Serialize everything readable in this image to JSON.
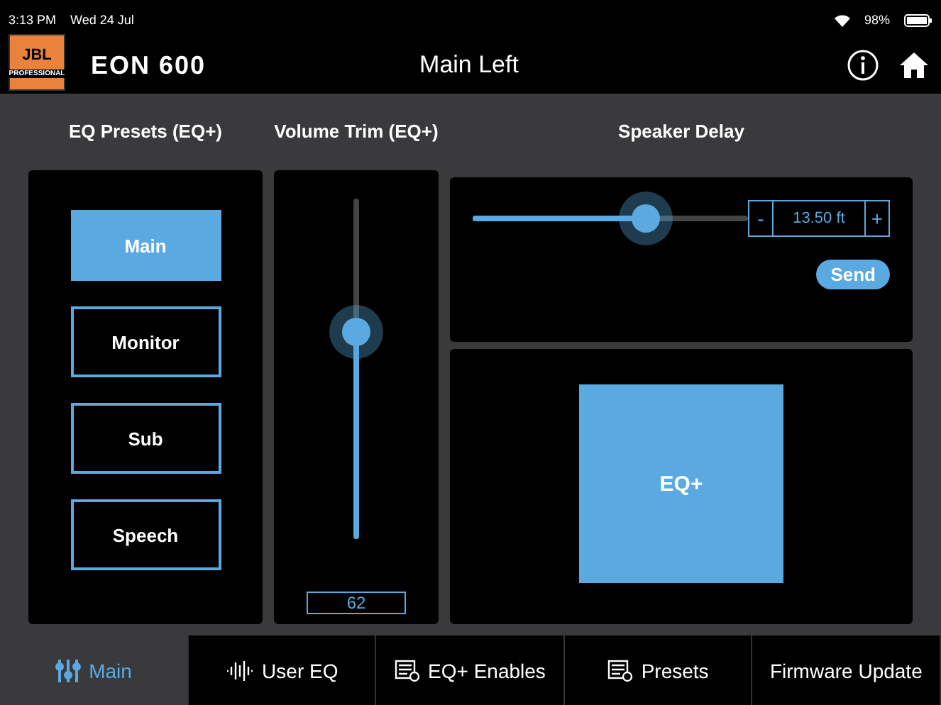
{
  "status_bar": {
    "time": "3:13 PM",
    "date": "Wed 24 Jul",
    "battery_text": "98%"
  },
  "header": {
    "logo": "JBL",
    "logo_sub": "PROFESSIONAL",
    "product": "EON 600",
    "title": "Main Left"
  },
  "eq_presets": {
    "heading": "EQ Presets (EQ+)",
    "items": [
      {
        "label": "Main",
        "selected": true
      },
      {
        "label": "Monitor",
        "selected": false
      },
      {
        "label": "Sub",
        "selected": false
      },
      {
        "label": "Speech",
        "selected": false
      }
    ]
  },
  "volume_trim": {
    "heading": "Volume Trim (EQ+)",
    "level": 0.61,
    "value": "62"
  },
  "speaker_delay": {
    "heading": "Speaker Delay",
    "level": 0.66,
    "minus": "-",
    "value": "13.50 ft",
    "plus": "+",
    "send": "Send"
  },
  "eq_plus_button": "EQ+",
  "tabs": [
    {
      "label": "Main",
      "kind": "sliders",
      "selected": true
    },
    {
      "label": "User EQ",
      "kind": "wave",
      "selected": false
    },
    {
      "label": "EQ+ Enables",
      "kind": "list",
      "selected": false
    },
    {
      "label": "Presets",
      "kind": "list",
      "selected": false
    },
    {
      "label": "Firmware Update",
      "kind": "none",
      "selected": false
    }
  ]
}
